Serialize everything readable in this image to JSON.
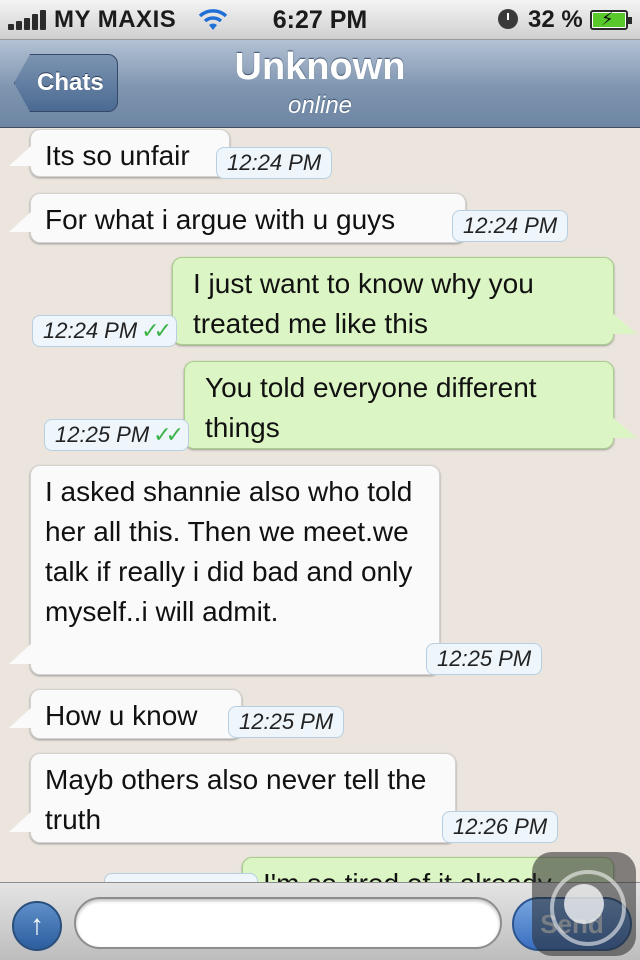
{
  "status_bar": {
    "carrier": "MY MAXIS",
    "time": "6:27 PM",
    "battery_percent": "32 %"
  },
  "nav": {
    "back_label": "Chats",
    "title": "Unknown",
    "subtitle": "online"
  },
  "messages": [
    {
      "direction": "in",
      "text": "Its so unfair",
      "time": "12:24 PM"
    },
    {
      "direction": "in",
      "text": "For what i argue with u guys",
      "time": "12:24 PM"
    },
    {
      "direction": "out",
      "text": "I just want to know why you treated me like this",
      "time": "12:24 PM",
      "ticks": "✓✓"
    },
    {
      "direction": "out",
      "text": "You told everyone different things",
      "time": "12:25 PM",
      "ticks": "✓✓"
    },
    {
      "direction": "in",
      "text": "I asked shannie also who told her all this. Then we meet.we talk if really i did bad and only myself..i will admit.",
      "time": "12:25 PM"
    },
    {
      "direction": "in",
      "text": "How u know",
      "time": "12:25 PM"
    },
    {
      "direction": "in",
      "text": "Mayb others also never tell the truth",
      "time": "12:26 PM"
    },
    {
      "direction": "out",
      "text": "I'm so tired of it already",
      "time": ""
    }
  ],
  "input": {
    "placeholder": "",
    "send_label": "Send"
  },
  "colors": {
    "incoming_bubble": "#fafafa",
    "outgoing_bubble": "#dcf5c4",
    "read_ticks": "#3cb34a",
    "nav_bar": "#7f95b0"
  }
}
